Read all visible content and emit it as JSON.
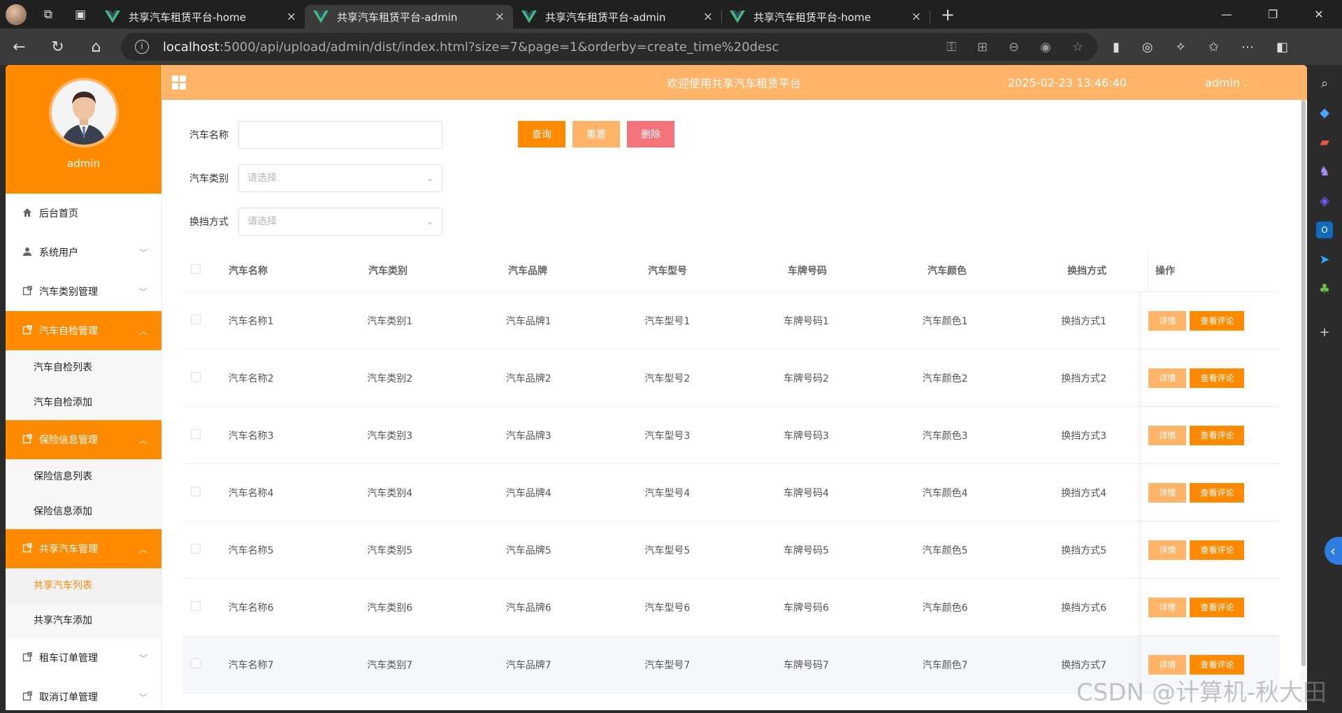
{
  "browser": {
    "tabs": [
      {
        "title": "共享汽车租赁平台-home",
        "active": false
      },
      {
        "title": "共享汽车租赁平台-admin",
        "active": true
      },
      {
        "title": "共享汽车租赁平台-admin",
        "active": false
      },
      {
        "title": "共享汽车租赁平台-home",
        "active": false
      }
    ],
    "url_host": "localhost",
    "url_rest": ":5000/api/upload/admin/dist/index.html?size=7&page=1&orderby=create_time%20desc",
    "info_glyph": "i",
    "new_tab_glyph": "+",
    "close_glyph": "×",
    "win": {
      "minimize": "—",
      "restore": "❐",
      "close": "✕"
    },
    "nav": {
      "back": "←",
      "reload": "↻",
      "home": "⌂"
    }
  },
  "sidebar": {
    "user": "admin",
    "menus": [
      {
        "label": "后台首页",
        "icon": "home-icon",
        "open": false,
        "arrow": false,
        "subs": []
      },
      {
        "label": "系统用户",
        "icon": "user-icon",
        "open": false,
        "arrow": true,
        "subs": []
      },
      {
        "label": "汽车类别管理",
        "icon": "doc-icon",
        "open": false,
        "arrow": true,
        "subs": []
      },
      {
        "label": "汽车自检管理",
        "icon": "doc-icon",
        "open": true,
        "arrow": true,
        "subs": [
          {
            "label": "汽车自检列表",
            "active": false
          },
          {
            "label": "汽车自检添加",
            "active": false
          }
        ]
      },
      {
        "label": "保险信息管理",
        "icon": "doc-icon",
        "open": true,
        "arrow": true,
        "subs": [
          {
            "label": "保险信息列表",
            "active": false
          },
          {
            "label": "保险信息添加",
            "active": false
          }
        ]
      },
      {
        "label": "共享汽车管理",
        "icon": "doc-icon",
        "open": true,
        "arrow": true,
        "subs": [
          {
            "label": "共享汽车列表",
            "active": true
          },
          {
            "label": "共享汽车添加",
            "active": false
          }
        ]
      },
      {
        "label": "租车订单管理",
        "icon": "doc-icon",
        "open": false,
        "arrow": true,
        "subs": []
      },
      {
        "label": "取消订单管理",
        "icon": "doc-icon",
        "open": false,
        "arrow": true,
        "subs": []
      }
    ]
  },
  "header": {
    "welcome": "欢迎使用共享汽车租赁平台",
    "time": "2025-02-23 13:46:40",
    "user": "admin"
  },
  "filters": {
    "name_label": "汽车名称",
    "name_value": "",
    "category_label": "汽车类别",
    "category_placeholder": "请选择",
    "gear_label": "换挡方式",
    "gear_placeholder": "请选择",
    "query_btn": "查询",
    "reset_btn": "重置",
    "delete_btn": "删除"
  },
  "table": {
    "columns": [
      "汽车名称",
      "汽车类别",
      "汽车品牌",
      "汽车型号",
      "车牌号码",
      "汽车颜色",
      "换挡方式",
      "操作"
    ],
    "rows": [
      [
        "汽车名称1",
        "汽车类别1",
        "汽车品牌1",
        "汽车型号1",
        "车牌号码1",
        "汽车颜色1",
        "换挡方式1"
      ],
      [
        "汽车名称2",
        "汽车类别2",
        "汽车品牌2",
        "汽车型号2",
        "车牌号码2",
        "汽车颜色2",
        "换挡方式2"
      ],
      [
        "汽车名称3",
        "汽车类别3",
        "汽车品牌3",
        "汽车型号3",
        "车牌号码3",
        "汽车颜色3",
        "换挡方式3"
      ],
      [
        "汽车名称4",
        "汽车类别4",
        "汽车品牌4",
        "汽车型号4",
        "车牌号码4",
        "汽车颜色4",
        "换挡方式4"
      ],
      [
        "汽车名称5",
        "汽车类别5",
        "汽车品牌5",
        "汽车型号5",
        "车牌号码5",
        "汽车颜色5",
        "换挡方式5"
      ],
      [
        "汽车名称6",
        "汽车类别6",
        "汽车品牌6",
        "汽车型号6",
        "车牌号码6",
        "汽车颜色6",
        "换挡方式6"
      ],
      [
        "汽车名称7",
        "汽车类别7",
        "汽车品牌7",
        "汽车型号7",
        "车牌号码7",
        "汽车颜色7",
        "换挡方式7"
      ]
    ],
    "detail_btn": "详情",
    "comment_btn": "查看评论"
  },
  "watermark": "CSDN @计算机-秋大田",
  "colors": {
    "primary": "#ff8a00",
    "header": "#ffb468",
    "reset": "#ffb468",
    "delete": "#f5737a",
    "detail": "#ffb468"
  }
}
